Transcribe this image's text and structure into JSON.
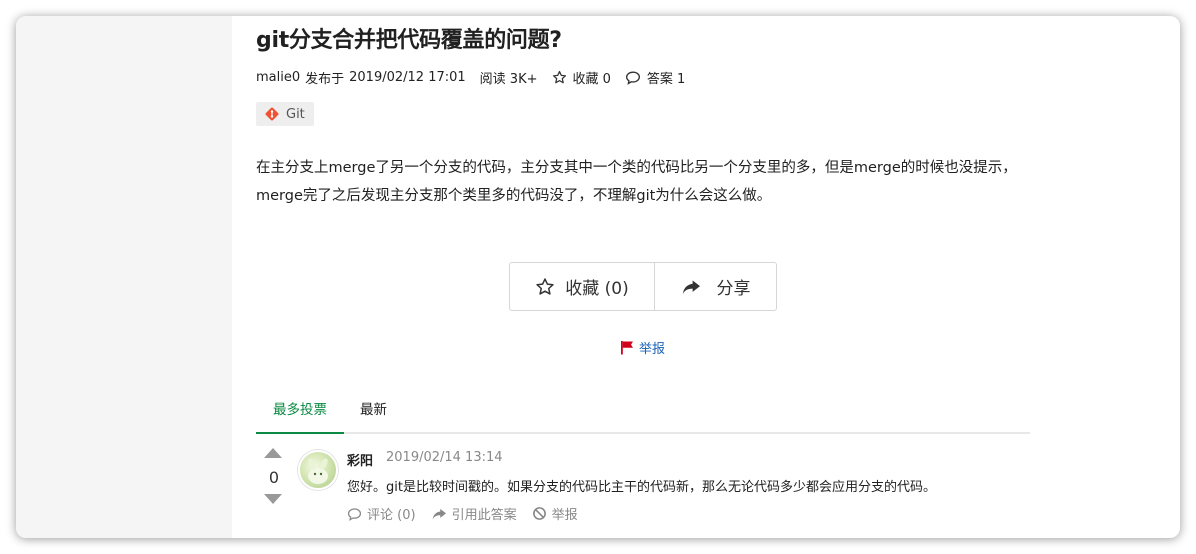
{
  "question": {
    "title": "git分支合并把代码覆盖的问题?",
    "author": "malie0",
    "published_prefix": "发布于",
    "published_date": "2019/02/12 17:01",
    "reads": "阅读 3K+",
    "favorites": "收藏 0",
    "answers": "答案 1",
    "tag": "Git",
    "body": "在主分支上merge了另一个分支的代码，主分支其中一个类的代码比另一个分支里的多，但是merge的时候也没提示，merge完了之后发现主分支那个类里多的代码没了，不理解git为什么会这么做。"
  },
  "buttons": {
    "favorite": "收藏 (0)",
    "share": "分享",
    "report": "举报"
  },
  "tabs": {
    "votes": "最多投票",
    "newest": "最新"
  },
  "answer": {
    "votes": "0",
    "author": "彩阳",
    "date": "2019/02/14 13:14",
    "text": "您好。git是比较时间戳的。如果分支的代码比主干的代码新，那么无论代码多少都会应用分支的代码。",
    "comment": "评论 (0)",
    "quote": "引用此答案",
    "report": "举报"
  },
  "colors": {
    "accent_green": "#0b8a42",
    "link_blue": "#1b62b8",
    "flag_red": "#d0021b",
    "git_orange": "#f05033"
  },
  "icons": [
    "star-icon",
    "comment-icon",
    "git-logo-icon",
    "share-icon",
    "flag-icon",
    "vote-up-icon",
    "vote-down-icon",
    "ban-icon"
  ]
}
